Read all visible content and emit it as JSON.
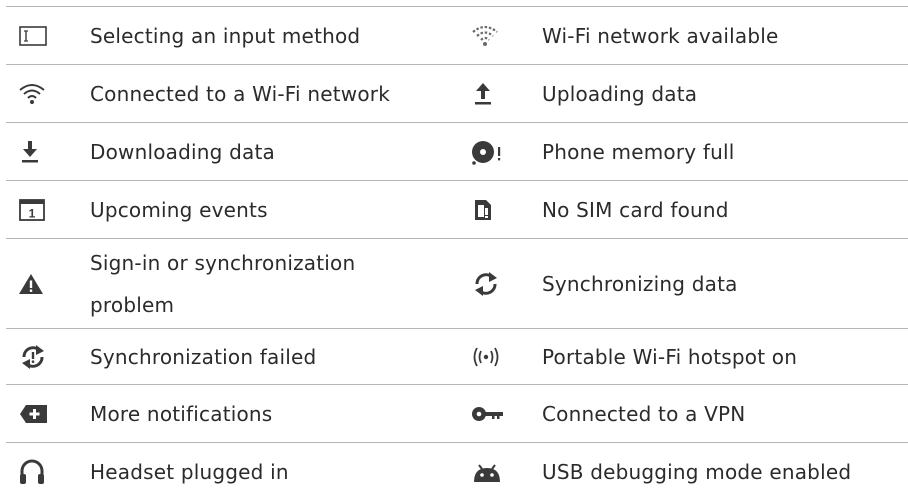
{
  "rows": [
    {
      "left": {
        "icon": "input-method-icon",
        "label": "Selecting an input method"
      },
      "right": {
        "icon": "wifi-available-icon",
        "label": "Wi-Fi network available"
      }
    },
    {
      "left": {
        "icon": "wifi-connected-icon",
        "label": "Connected to a Wi-Fi network"
      },
      "right": {
        "icon": "upload-icon",
        "label": "Uploading data"
      }
    },
    {
      "left": {
        "icon": "download-icon",
        "label": "Downloading data"
      },
      "right": {
        "icon": "memory-full-icon",
        "label": "Phone memory full"
      }
    },
    {
      "left": {
        "icon": "calendar-event-icon",
        "label": "Upcoming events",
        "icon_text": "1"
      },
      "right": {
        "icon": "no-sim-icon",
        "label": "No SIM card found"
      }
    },
    {
      "left": {
        "icon": "warning-icon",
        "label_line1": "Sign-in or synchronization",
        "label_line2": "problem"
      },
      "right": {
        "icon": "sync-icon",
        "label": "Synchronizing data"
      }
    },
    {
      "left": {
        "icon": "sync-failed-icon",
        "label": "Synchronization failed"
      },
      "right": {
        "icon": "hotspot-icon",
        "label": "Portable Wi-Fi hotspot on"
      }
    },
    {
      "left": {
        "icon": "more-notifications-icon",
        "label": "More notifications"
      },
      "right": {
        "icon": "vpn-key-icon",
        "label": "Connected to a VPN"
      }
    },
    {
      "left": {
        "icon": "headset-icon",
        "label": "Headset plugged in"
      },
      "right": {
        "icon": "android-debug-icon",
        "label": "USB debugging mode enabled"
      }
    }
  ],
  "colors": {
    "icon": "#3a3a3a",
    "text": "#2b2b2b",
    "divider": "#b5b5b5"
  }
}
